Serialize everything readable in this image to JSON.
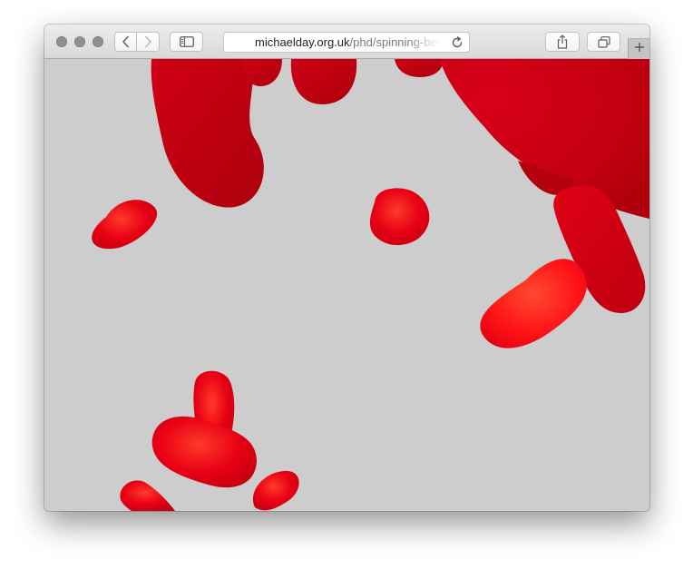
{
  "browser": {
    "address_bar": {
      "domain": "michaelday.org.uk",
      "path": "/phd/spinning-bea"
    },
    "icons": {
      "back": "chevron-left-icon",
      "forward": "chevron-right-icon",
      "sidebar": "sidebar-icon",
      "reload": "reload-icon",
      "share": "share-icon",
      "tabs": "tabs-overview-icon",
      "new_tab": "plus-icon"
    }
  },
  "page": {
    "background_color": "#cdcdcd",
    "scene": "red spinning bean shapes",
    "bean_colors": {
      "dark": "#b60010",
      "mid": "#d60012",
      "bright": "#ff1818"
    }
  }
}
